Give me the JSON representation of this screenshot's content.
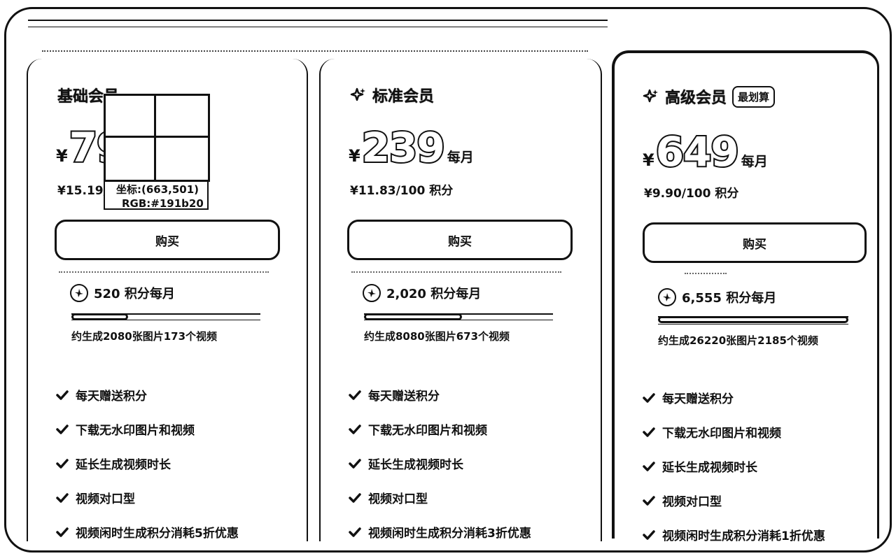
{
  "plans": [
    {
      "title": "基础会员",
      "badge": "",
      "currency": "¥",
      "price": "79",
      "per": "每月",
      "per_credit": "¥15.19/100 积分",
      "buy_label": "购买",
      "credits": "520 积分每月",
      "progress": 0.3,
      "generate": "约生成2080张图片173个视频",
      "features": [
        "每天赠送积分",
        "下载无水印图片和视频",
        "延长生成视频时长",
        "视频对口型",
        "视频闲时生成积分消耗5折优惠"
      ]
    },
    {
      "title": "标准会员",
      "badge": "",
      "currency": "¥",
      "price": "239",
      "per": "每月",
      "per_credit": "¥11.83/100 积分",
      "buy_label": "购买",
      "credits": "2,020 积分每月",
      "progress": 0.52,
      "generate": "约生成8080张图片673个视频",
      "features": [
        "每天赠送积分",
        "下载无水印图片和视频",
        "延长生成视频时长",
        "视频对口型",
        "视频闲时生成积分消耗3折优惠"
      ]
    },
    {
      "title": "高级会员",
      "badge": "最划算",
      "currency": "¥",
      "price": "649",
      "per": "每月",
      "per_credit": "¥9.90/100 积分",
      "buy_label": "购买",
      "credits": "6,555 积分每月",
      "progress": 1.0,
      "generate": "约生成26220张图片2185个视频",
      "features": [
        "每天赠送积分",
        "下载无水印图片和视频",
        "延长生成视频时长",
        "视频对口型",
        "视频闲时生成积分消耗1折优惠"
      ]
    }
  ],
  "tooltip": {
    "coord": "坐标:(663,501)",
    "rgb": "RGB:#191b20"
  },
  "icons": {
    "title_icon": "sparkle-icon",
    "credit_icon": "credit-coin-icon",
    "feature_icon": "check-icon"
  }
}
